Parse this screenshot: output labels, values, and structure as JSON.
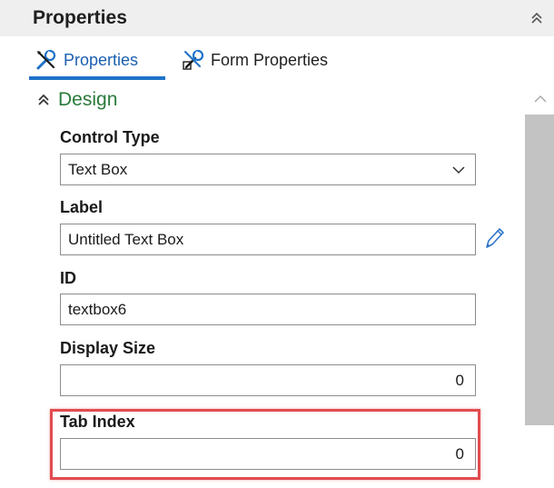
{
  "panel": {
    "title": "Properties",
    "collapse_icon": "double-chevron-up-icon"
  },
  "tabs": [
    {
      "label": "Properties",
      "icon": "tools-icon",
      "active": true
    },
    {
      "label": "Form Properties",
      "icon": "form-tools-icon",
      "active": false
    }
  ],
  "section": {
    "title": "Design",
    "expanded": true,
    "icon": "double-chevron-up-icon"
  },
  "fields": {
    "control_type": {
      "label": "Control Type",
      "value": "Text Box",
      "icon": "chevron-down-icon"
    },
    "label": {
      "label": "Label",
      "value": "Untitled Text Box",
      "edit_icon": "pencil-icon"
    },
    "id": {
      "label": "ID",
      "value": "textbox6"
    },
    "display_size": {
      "label": "Display Size",
      "value": "0"
    },
    "tab_index": {
      "label": "Tab Index",
      "value": "0",
      "highlighted": true
    }
  },
  "colors": {
    "accent": "#1f72c8",
    "section_title": "#2a7a3a",
    "highlight": "#e14b4f",
    "header_bg": "#efefef",
    "scrollbar": "#c3c3c3"
  }
}
